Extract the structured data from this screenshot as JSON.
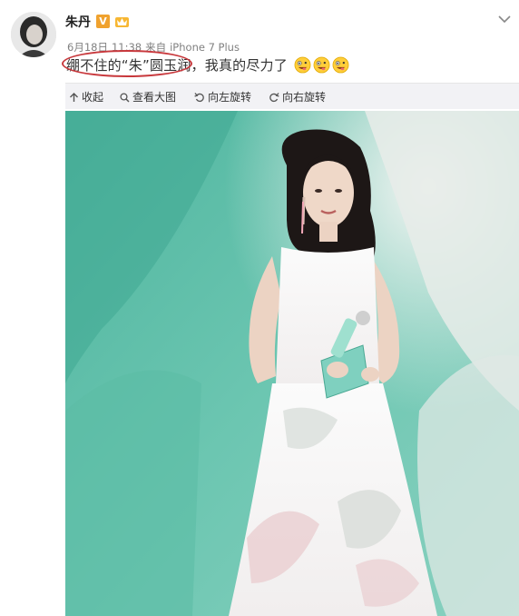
{
  "post": {
    "username": "朱丹",
    "verified_badge": "V",
    "meta": {
      "date": "6月18日",
      "time": "11:38",
      "source_prefix": "来自",
      "device": "iPhone 7 Plus"
    },
    "text": "绷不住的“朱”圆玉润，我真的尽力了",
    "emoji_count": 3,
    "emoji_name": "crazy-face-emoji"
  },
  "toolbar": {
    "collapse_label": "收起",
    "view_large_label": "查看大图",
    "rotate_left_label": "向左旋转",
    "rotate_right_label": "向右旋转"
  },
  "colors": {
    "annotation_oval": "#c8383c",
    "toolbar_bg": "#f2f2f5",
    "photo_background": "#5fbfaa",
    "verified_badge": "#f0a22e"
  }
}
